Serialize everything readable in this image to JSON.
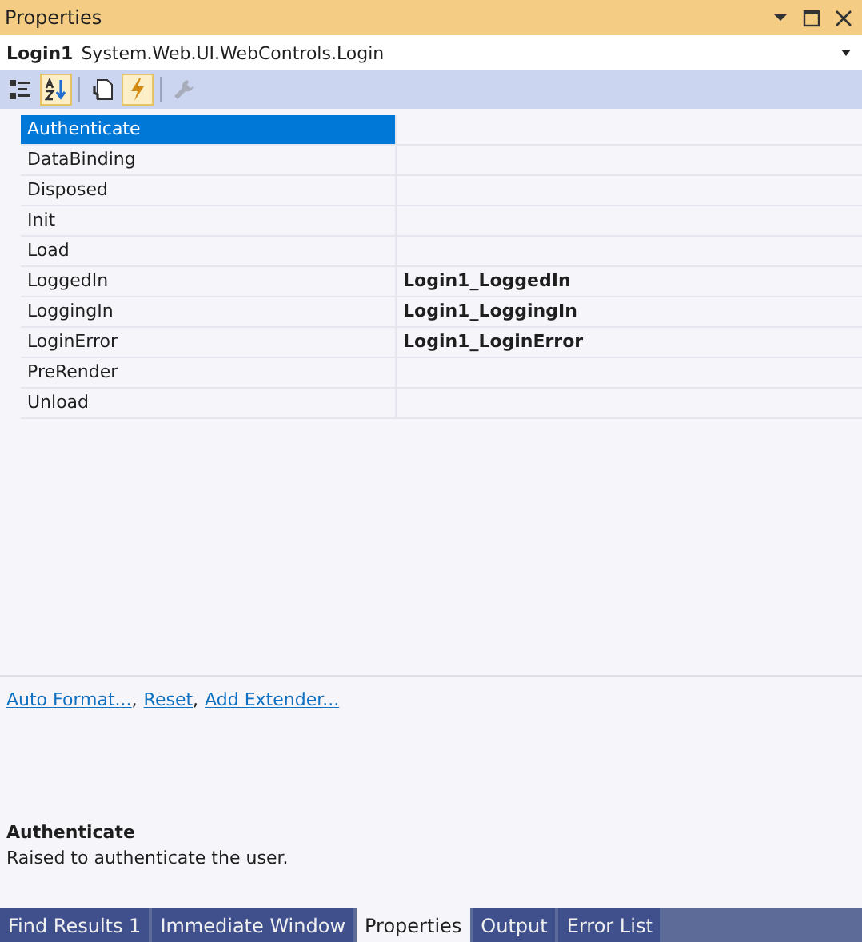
{
  "window": {
    "title": "Properties"
  },
  "object_selector": {
    "name": "Login1",
    "type": "System.Web.UI.WebControls.Login"
  },
  "toolbar": [
    {
      "kind": "categorized",
      "selected": false,
      "disabled": false
    },
    {
      "kind": "alphabetical",
      "selected": true,
      "disabled": false
    },
    {
      "kind": "separator"
    },
    {
      "kind": "properties",
      "selected": false,
      "disabled": false
    },
    {
      "kind": "events",
      "selected": true,
      "disabled": false
    },
    {
      "kind": "separator"
    },
    {
      "kind": "pages",
      "selected": false,
      "disabled": true
    }
  ],
  "events": [
    {
      "name": "Authenticate",
      "selected": true
    },
    {
      "name": "DataBinding",
      "selected": false
    },
    {
      "name": "Disposed",
      "selected": false
    },
    {
      "name": "Init",
      "selected": false
    },
    {
      "name": "Load",
      "selected": false
    },
    {
      "name": "LoggedIn",
      "handler": "Login1_LoggedIn",
      "selected": false
    },
    {
      "name": "LoggingIn",
      "handler": "Login1_LoggingIn",
      "selected": false
    },
    {
      "name": "LoginError",
      "handler": "Login1_LoginError",
      "selected": false
    },
    {
      "name": "PreRender",
      "selected": false
    },
    {
      "name": "Unload",
      "selected": false
    }
  ],
  "commands": [
    {
      "label": "Auto Format...",
      "separator": ","
    },
    {
      "label": "Reset",
      "separator": ","
    },
    {
      "label": "Add Extender..."
    }
  ],
  "description": {
    "title": "Authenticate",
    "text": "Raised to authenticate the user."
  },
  "tabs": [
    {
      "label": "Find Results 1",
      "selected": false
    },
    {
      "label": "Immediate Window",
      "selected": false
    },
    {
      "label": "Properties",
      "selected": true
    },
    {
      "label": "Output",
      "selected": false
    },
    {
      "label": "Error List",
      "selected": false
    }
  ]
}
